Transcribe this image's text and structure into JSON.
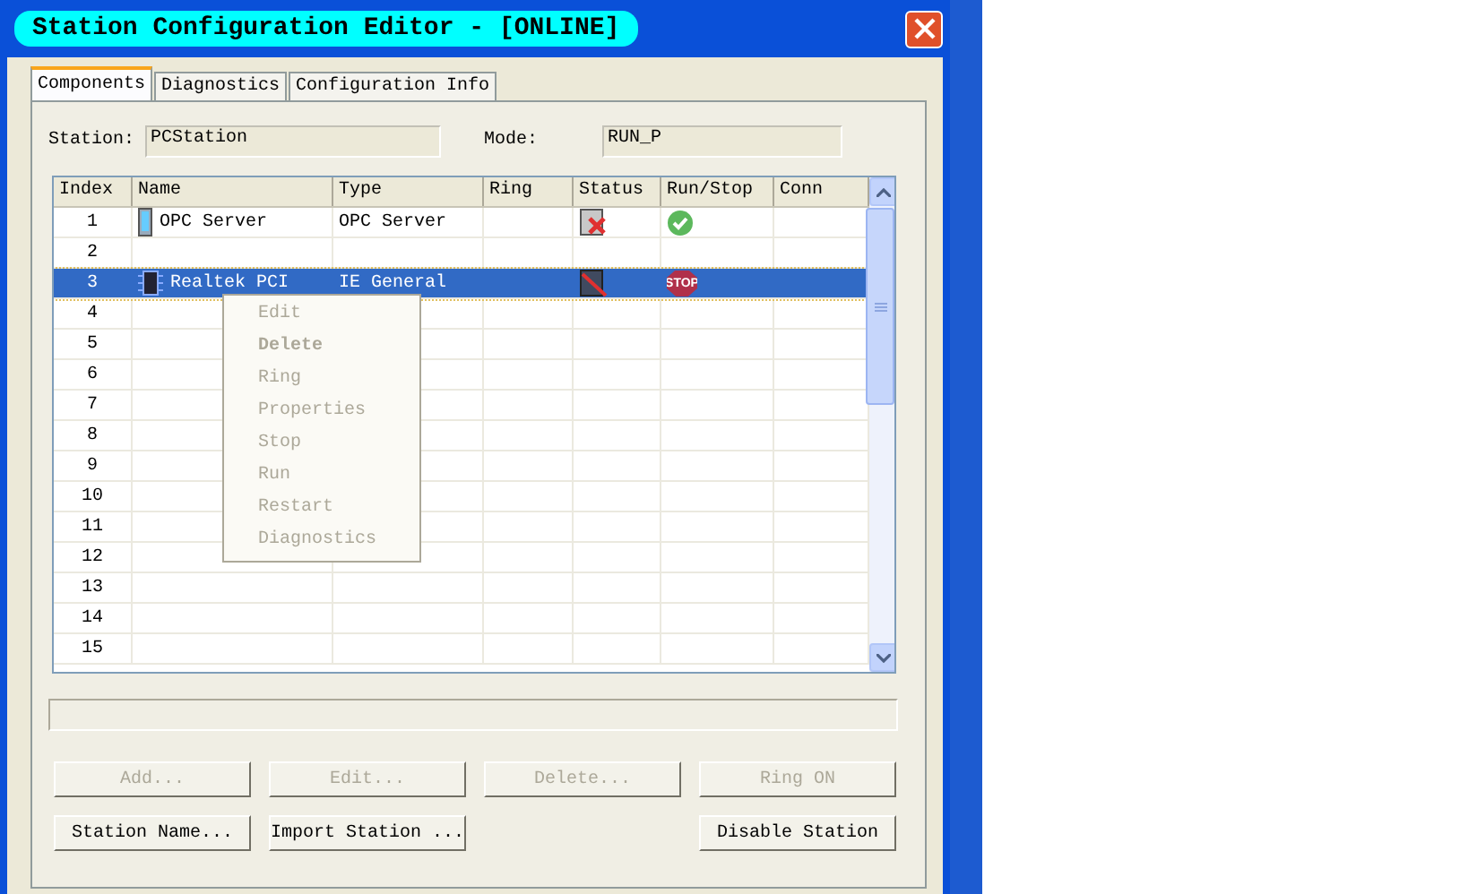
{
  "window": {
    "title": "Station Configuration Editor - [ONLINE]"
  },
  "tabs": [
    {
      "label": "Components",
      "selected": true
    },
    {
      "label": "Diagnostics",
      "selected": false
    },
    {
      "label": "Configuration Info",
      "selected": false
    }
  ],
  "station": {
    "label": "Station:",
    "value": "PCStation"
  },
  "mode": {
    "label": "Mode:",
    "value": "RUN_P"
  },
  "table": {
    "columns": [
      "Index",
      "Name",
      "Type",
      "Ring",
      "Status",
      "Run/Stop",
      "Conn"
    ],
    "rows": [
      {
        "index": "1",
        "name": "OPC Server",
        "name_icon": {
          "kind": "server"
        },
        "type": "OPC Server",
        "status": {
          "kind": "fault"
        },
        "run_stop": {
          "kind": "running"
        },
        "selected": false
      },
      {
        "index": "2",
        "selected": false
      },
      {
        "index": "3",
        "name": "Realtek PCI",
        "name_icon": {
          "kind": "card"
        },
        "type": "IE General",
        "status": {
          "kind": "disconnected"
        },
        "run_stop": {
          "kind": "stopped",
          "label": "STOP"
        },
        "selected": true
      },
      {
        "index": "4",
        "selected": false
      },
      {
        "index": "5",
        "selected": false
      },
      {
        "index": "6",
        "selected": false
      },
      {
        "index": "7",
        "selected": false
      },
      {
        "index": "8",
        "selected": false
      },
      {
        "index": "9",
        "selected": false
      },
      {
        "index": "10",
        "selected": false
      },
      {
        "index": "11",
        "selected": false
      },
      {
        "index": "12",
        "selected": false
      },
      {
        "index": "13",
        "selected": false
      },
      {
        "index": "14",
        "selected": false
      },
      {
        "index": "15",
        "selected": false
      }
    ]
  },
  "context_menu": [
    {
      "label": "Edit",
      "disabled": true,
      "default": false
    },
    {
      "label": "Delete",
      "disabled": true,
      "default": true
    },
    {
      "label": "Ring",
      "disabled": true,
      "default": false
    },
    {
      "label": "Properties",
      "disabled": true,
      "default": false
    },
    {
      "label": "Stop",
      "disabled": true,
      "default": false
    },
    {
      "label": "Run",
      "disabled": true,
      "default": false
    },
    {
      "label": "Restart",
      "disabled": true,
      "default": false
    },
    {
      "label": "Diagnostics",
      "disabled": true,
      "default": false
    }
  ],
  "button_rows": [
    {
      "left": [
        {
          "label": "Add...",
          "disabled": true
        },
        {
          "label": "Edit...",
          "disabled": true
        },
        {
          "label": "Delete...",
          "disabled": true
        },
        {
          "label": "Ring ON",
          "disabled": true
        }
      ]
    },
    {
      "left": [
        {
          "label": "Station Name...",
          "disabled": false
        },
        {
          "label": "Import Station ...",
          "disabled": false
        }
      ],
      "right": [
        {
          "label": "Disable Station",
          "disabled": false
        }
      ]
    }
  ]
}
